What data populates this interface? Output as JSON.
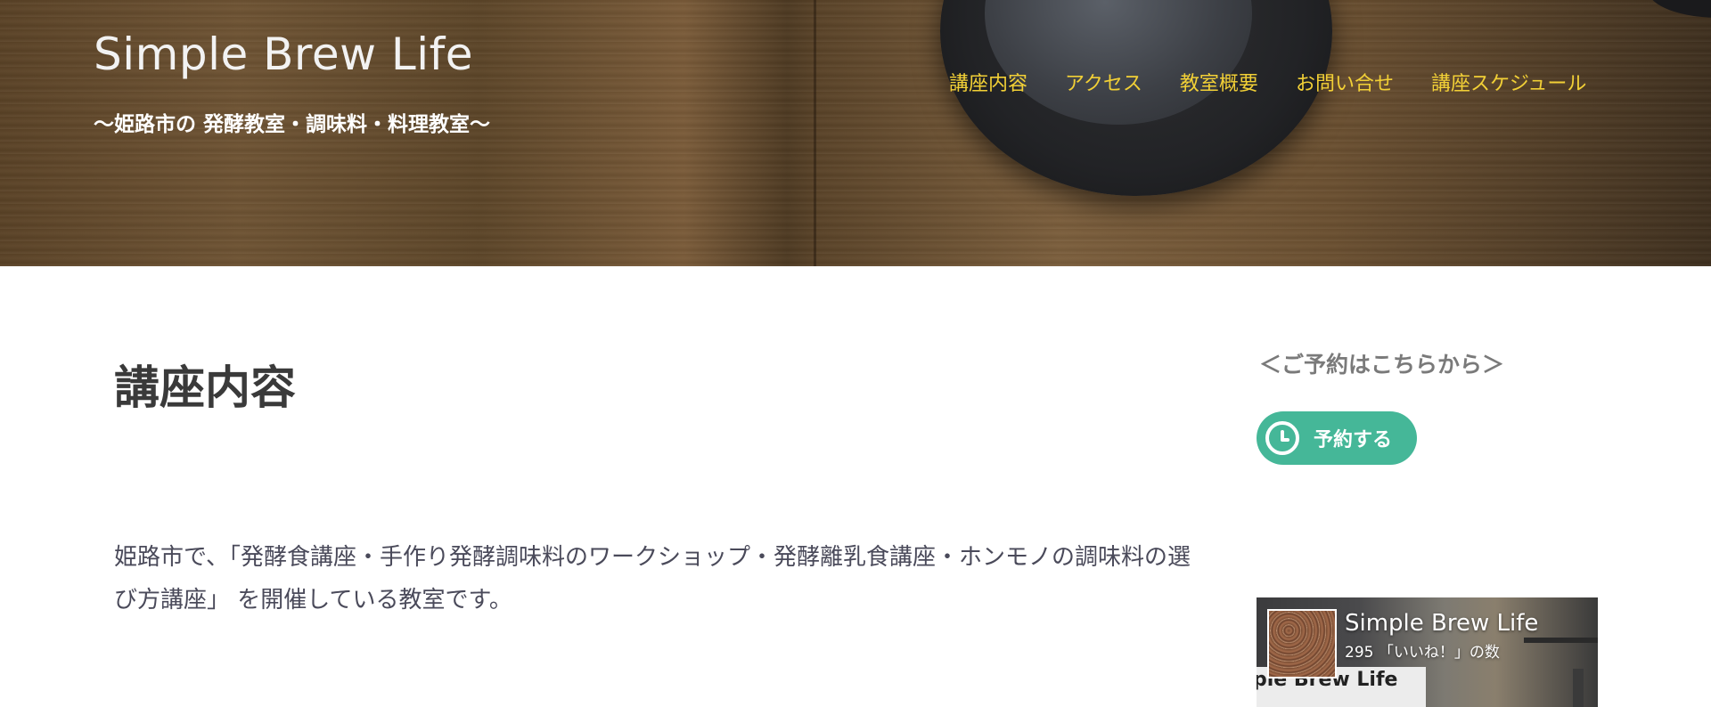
{
  "header": {
    "site_title": "Simple Brew Life",
    "tagline": "〜姫路市の 発酵教室・調味料・料理教室〜",
    "nav": [
      {
        "label": "講座内容"
      },
      {
        "label": "アクセス"
      },
      {
        "label": "教室概要"
      },
      {
        "label": "お問い合せ"
      },
      {
        "label": "講座スケジュール"
      }
    ]
  },
  "main": {
    "title": "講座内容",
    "intro": "姫路市で、「発酵食講座・手作り発酵調味料のワークショップ・発酵離乳食講座・ホンモノの調味料の選び方講座」 を開催している教室です。"
  },
  "sidebar": {
    "heading": "＜ご予約はこちらから＞",
    "reserve_button_label": "予約する",
    "reserve_icon": "clock-icon",
    "facebook": {
      "page_name": "Simple Brew Life",
      "likes": "295 「いいね！」の数",
      "banner_text": "ple Brew Life"
    }
  },
  "colors": {
    "nav_link": "#f2d036",
    "reserve_button": "#45b798",
    "heading_text": "#3a3a3a",
    "body_text": "#4a4a5a"
  }
}
